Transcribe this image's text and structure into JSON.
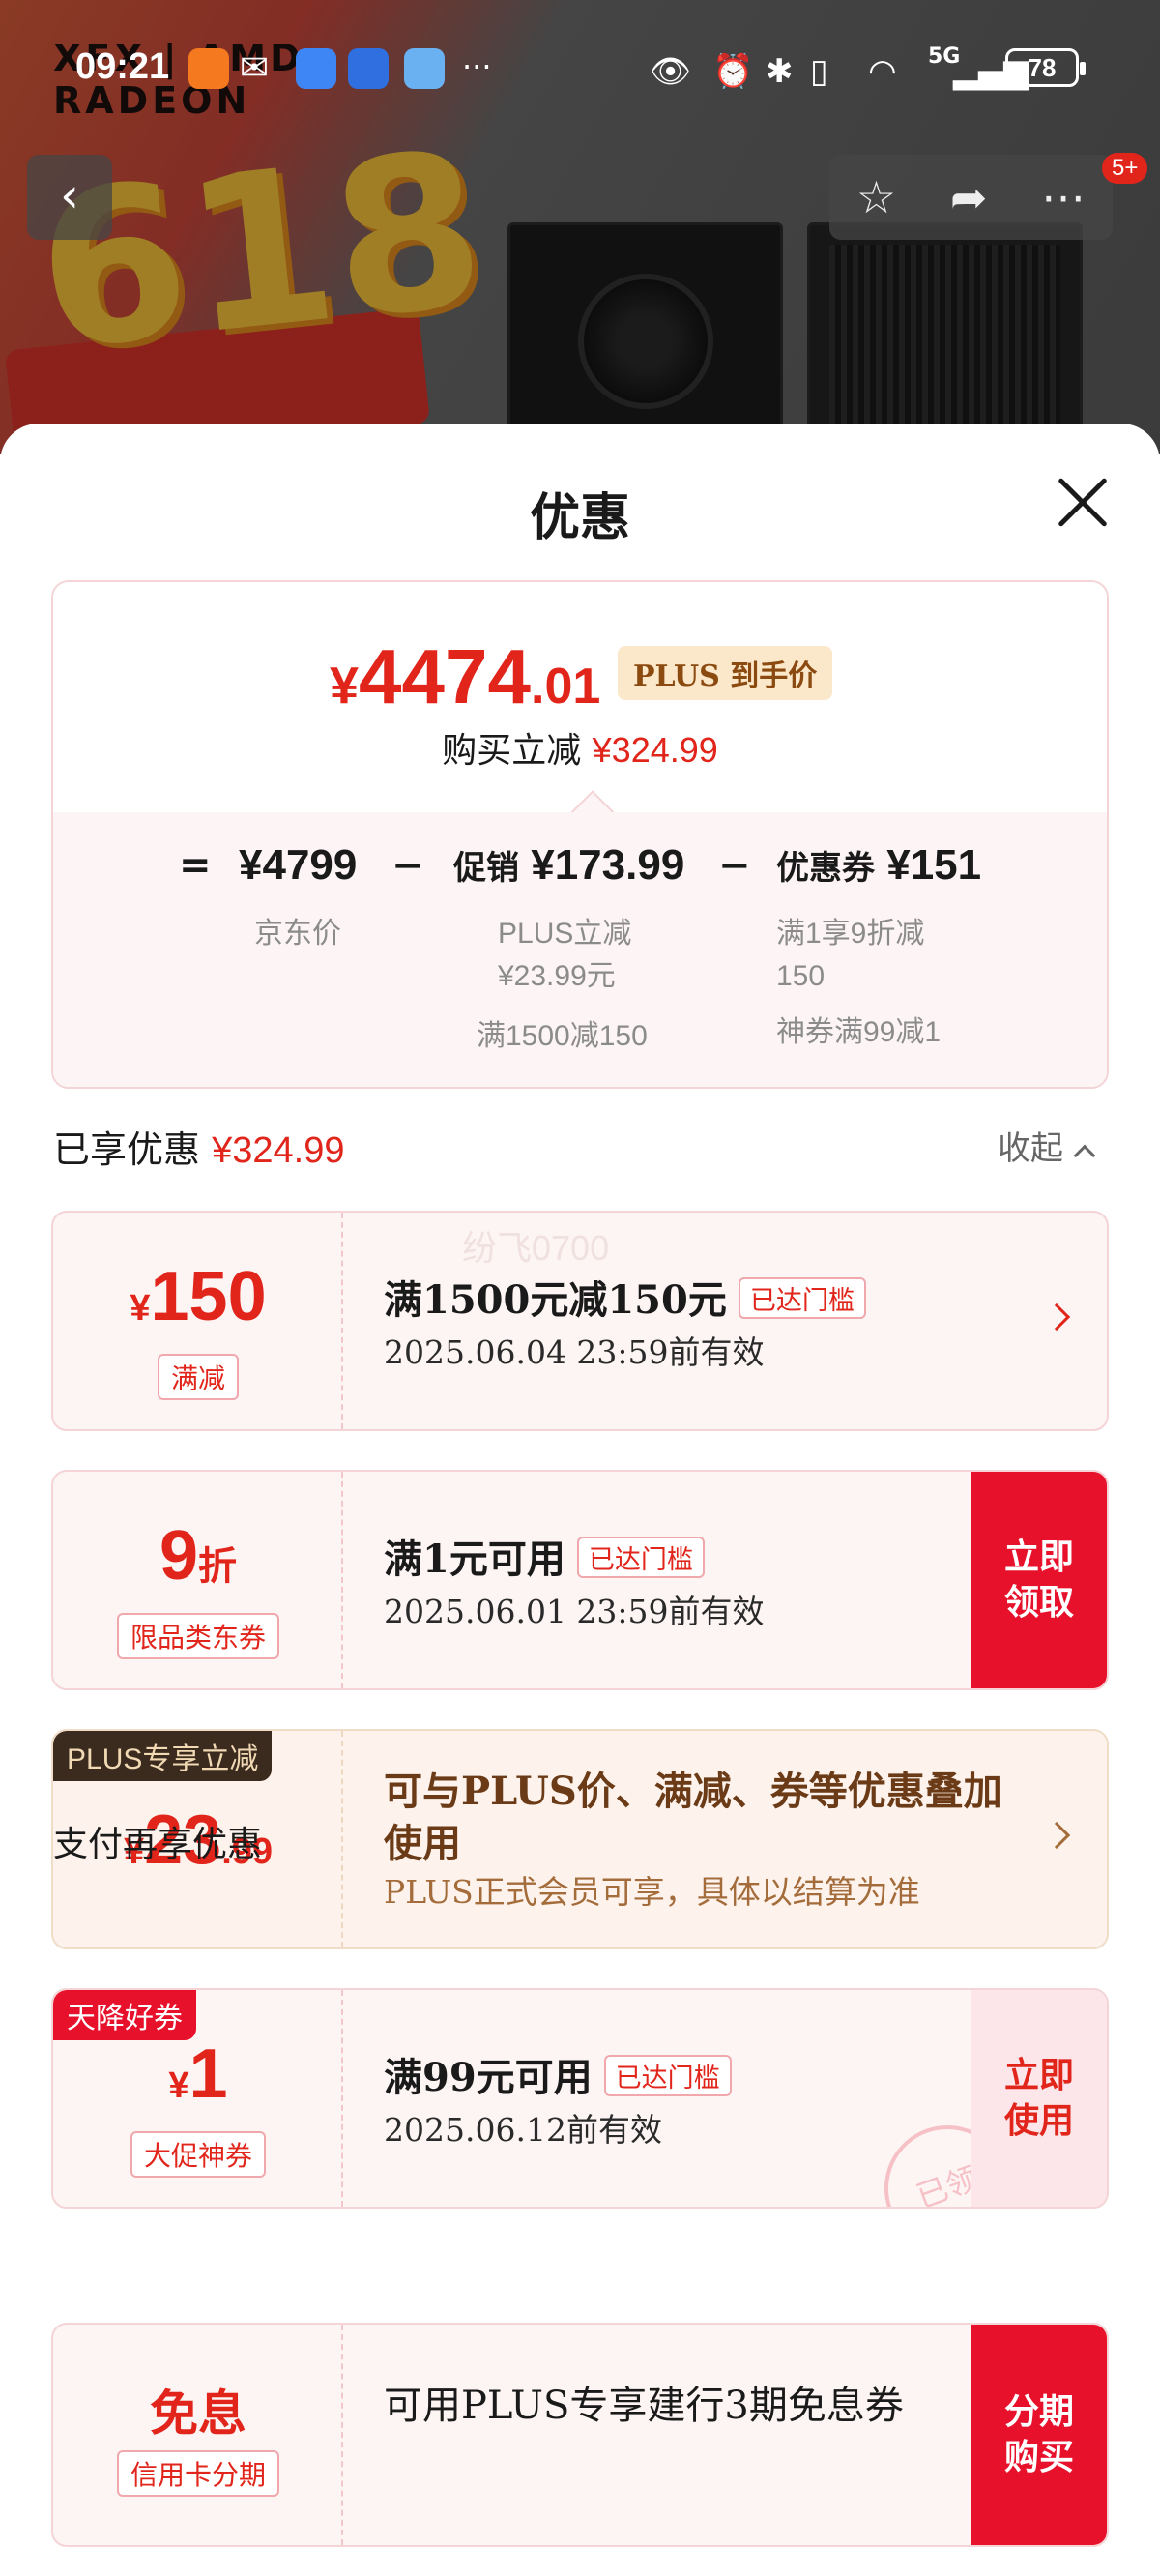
{
  "status_bar": {
    "time": "09:21",
    "more": "···",
    "battery": "78",
    "network": "5G"
  },
  "backdrop": {
    "promo": "618",
    "brand": "XFX | AMD RADEON"
  },
  "nav": {
    "badge": "5+"
  },
  "sheet": {
    "title": "优惠",
    "summary": {
      "final_currency": "¥",
      "final_int": "4474",
      "final_dec": ".01",
      "plus_label": "PLUS 到手价",
      "reduce_label": "购买立减",
      "reduce_amount": "¥324.99",
      "eq": "=",
      "minus": "−",
      "jd_price": "¥4799",
      "jd_label": "京东价",
      "promo_label": "促销",
      "promo_amount": "¥173.99",
      "promo_sub1": "PLUS立减",
      "promo_sub2": "¥23.99元",
      "promo_sub3": "满1500减150",
      "coupon_label": "优惠券",
      "coupon_amount": "¥151",
      "coupon_sub1": "满1享9折减",
      "coupon_sub2": "150",
      "coupon_sub3": "神券满99减1"
    },
    "enjoyed_label": "已享优惠",
    "enjoyed_amount": "¥324.99",
    "collapse_label": "收起",
    "watermark": "纷飞0700",
    "coupons": [
      {
        "cur": "¥",
        "num": "150",
        "tag": "满减",
        "title": "满1500元减150元",
        "reached": "已达门槛",
        "date": "2025.06.04 23:59前有效"
      },
      {
        "num": "9",
        "unit": "折",
        "tag": "限品类东券",
        "title": "满1元可用",
        "reached": "已达门槛",
        "date": "2025.06.01 23:59前有效",
        "action": "立即\n领取"
      },
      {
        "corner": "PLUS专享立减",
        "cur": "¥",
        "num": "23",
        "dec": ".99",
        "title": "可与PLUS价、满减、券等优惠叠加使用",
        "desc": "PLUS正式会员可享，具体以结算为准"
      },
      {
        "corner": "天降好券",
        "cur": "¥",
        "num": "1",
        "tag": "大促神券",
        "title": "满99元可用",
        "reached": "已达门槛",
        "date": "2025.06.12前有效",
        "action": "立即\n使用",
        "stamp": "已领"
      }
    ],
    "pay_title": "支付再享优惠",
    "pay_card": {
      "big": "免息",
      "tag": "信用卡分期",
      "title": "可用PLUS专享建行3期免息券",
      "action": "分期\n购买"
    }
  }
}
